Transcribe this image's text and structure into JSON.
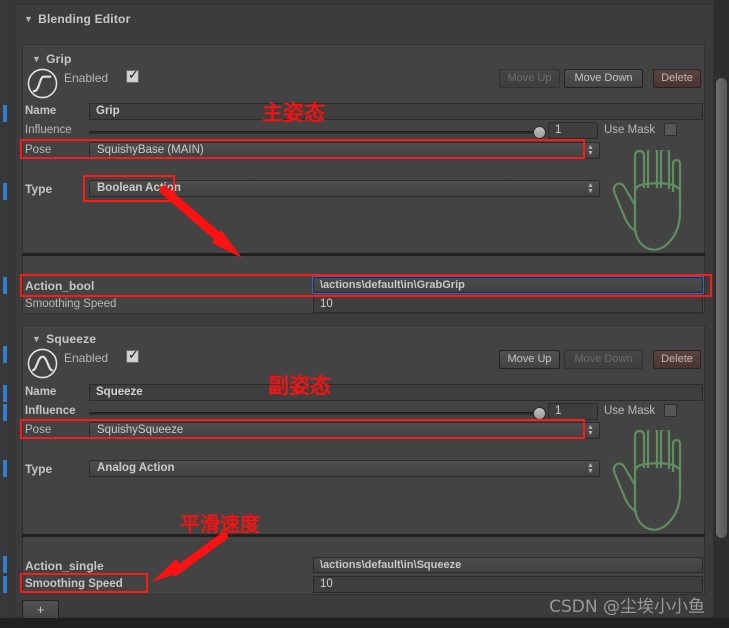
{
  "editor": {
    "title": "Blending Editor",
    "add_button": "+"
  },
  "sections": [
    {
      "title": "Grip",
      "icon": "step-curve-icon",
      "enabled_label": "Enabled",
      "enabled_checked": true,
      "move_up": "Move Up",
      "move_up_enabled": false,
      "move_down": "Move Down",
      "move_down_enabled": true,
      "delete": "Delete",
      "name_label": "Name",
      "name_value": "Grip",
      "influence_label": "Influence",
      "influence_value": "1",
      "use_mask_label": "Use Mask",
      "use_mask_checked": false,
      "pose_label": "Pose",
      "pose_value": "SquishyBase (MAIN)",
      "type_label": "Type",
      "type_value": "Boolean Action",
      "action_label": "Action_bool",
      "action_value": "\\actions\\default\\in\\GrabGrip",
      "smoothing_label": "Smoothing Speed",
      "smoothing_value": "10",
      "hand_icon": "hand-outline-icon"
    },
    {
      "title": "Squeeze",
      "icon": "arch-curve-icon",
      "enabled_label": "Enabled",
      "enabled_checked": true,
      "move_up": "Move Up",
      "move_up_enabled": true,
      "move_down": "Move Down",
      "move_down_enabled": false,
      "delete": "Delete",
      "name_label": "Name",
      "name_value": "Squeeze",
      "influence_label": "Influence",
      "influence_value": "1",
      "use_mask_label": "Use Mask",
      "use_mask_checked": false,
      "pose_label": "Pose",
      "pose_value": "SquishySqueeze",
      "type_label": "Type",
      "type_value": "Analog Action",
      "action_label": "Action_single",
      "action_value": "\\actions\\default\\in\\Squeeze",
      "smoothing_label": "Smoothing Speed",
      "smoothing_value": "10",
      "hand_icon": "hand-outline-icon"
    }
  ],
  "annotations": [
    {
      "text": "主姿态",
      "note": "main-pose"
    },
    {
      "text": "副姿态",
      "note": "secondary-pose"
    },
    {
      "text": "平滑速度",
      "note": "smoothing-speed"
    }
  ],
  "watermark": "CSDN @尘埃小小鱼"
}
